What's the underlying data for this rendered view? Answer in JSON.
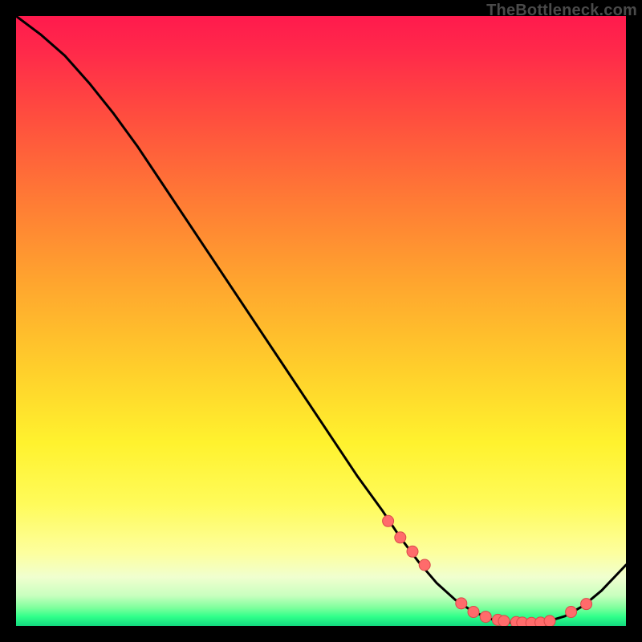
{
  "watermark": "TheBottleneck.com",
  "colors": {
    "curve": "#000000",
    "dot_fill": "#ff6b6b",
    "dot_stroke": "#d94a4a"
  },
  "chart_data": {
    "type": "line",
    "title": "",
    "xlabel": "",
    "ylabel": "",
    "xlim": [
      0,
      100
    ],
    "ylim": [
      0,
      100
    ],
    "x": [
      0,
      4,
      8,
      12,
      16,
      20,
      24,
      28,
      32,
      36,
      40,
      44,
      48,
      52,
      56,
      60,
      63,
      66,
      69,
      72,
      75,
      78,
      81,
      84,
      87,
      90,
      93,
      96,
      100
    ],
    "y": [
      100,
      97,
      93.5,
      89,
      84,
      78.5,
      72.5,
      66.5,
      60.5,
      54.5,
      48.5,
      42.5,
      36.5,
      30.5,
      24.5,
      19,
      14.5,
      10.5,
      7,
      4.3,
      2.3,
      1.1,
      0.55,
      0.45,
      0.7,
      1.6,
      3.3,
      5.8,
      10
    ],
    "dots_x": [
      61,
      63,
      65,
      67,
      73,
      75,
      77,
      79,
      80,
      82,
      83,
      84.5,
      86,
      87.5,
      91,
      93.5
    ],
    "dots_y": [
      17.2,
      14.5,
      12.2,
      10.0,
      3.7,
      2.3,
      1.5,
      1.0,
      0.8,
      0.62,
      0.55,
      0.5,
      0.55,
      0.8,
      2.3,
      3.6
    ]
  }
}
